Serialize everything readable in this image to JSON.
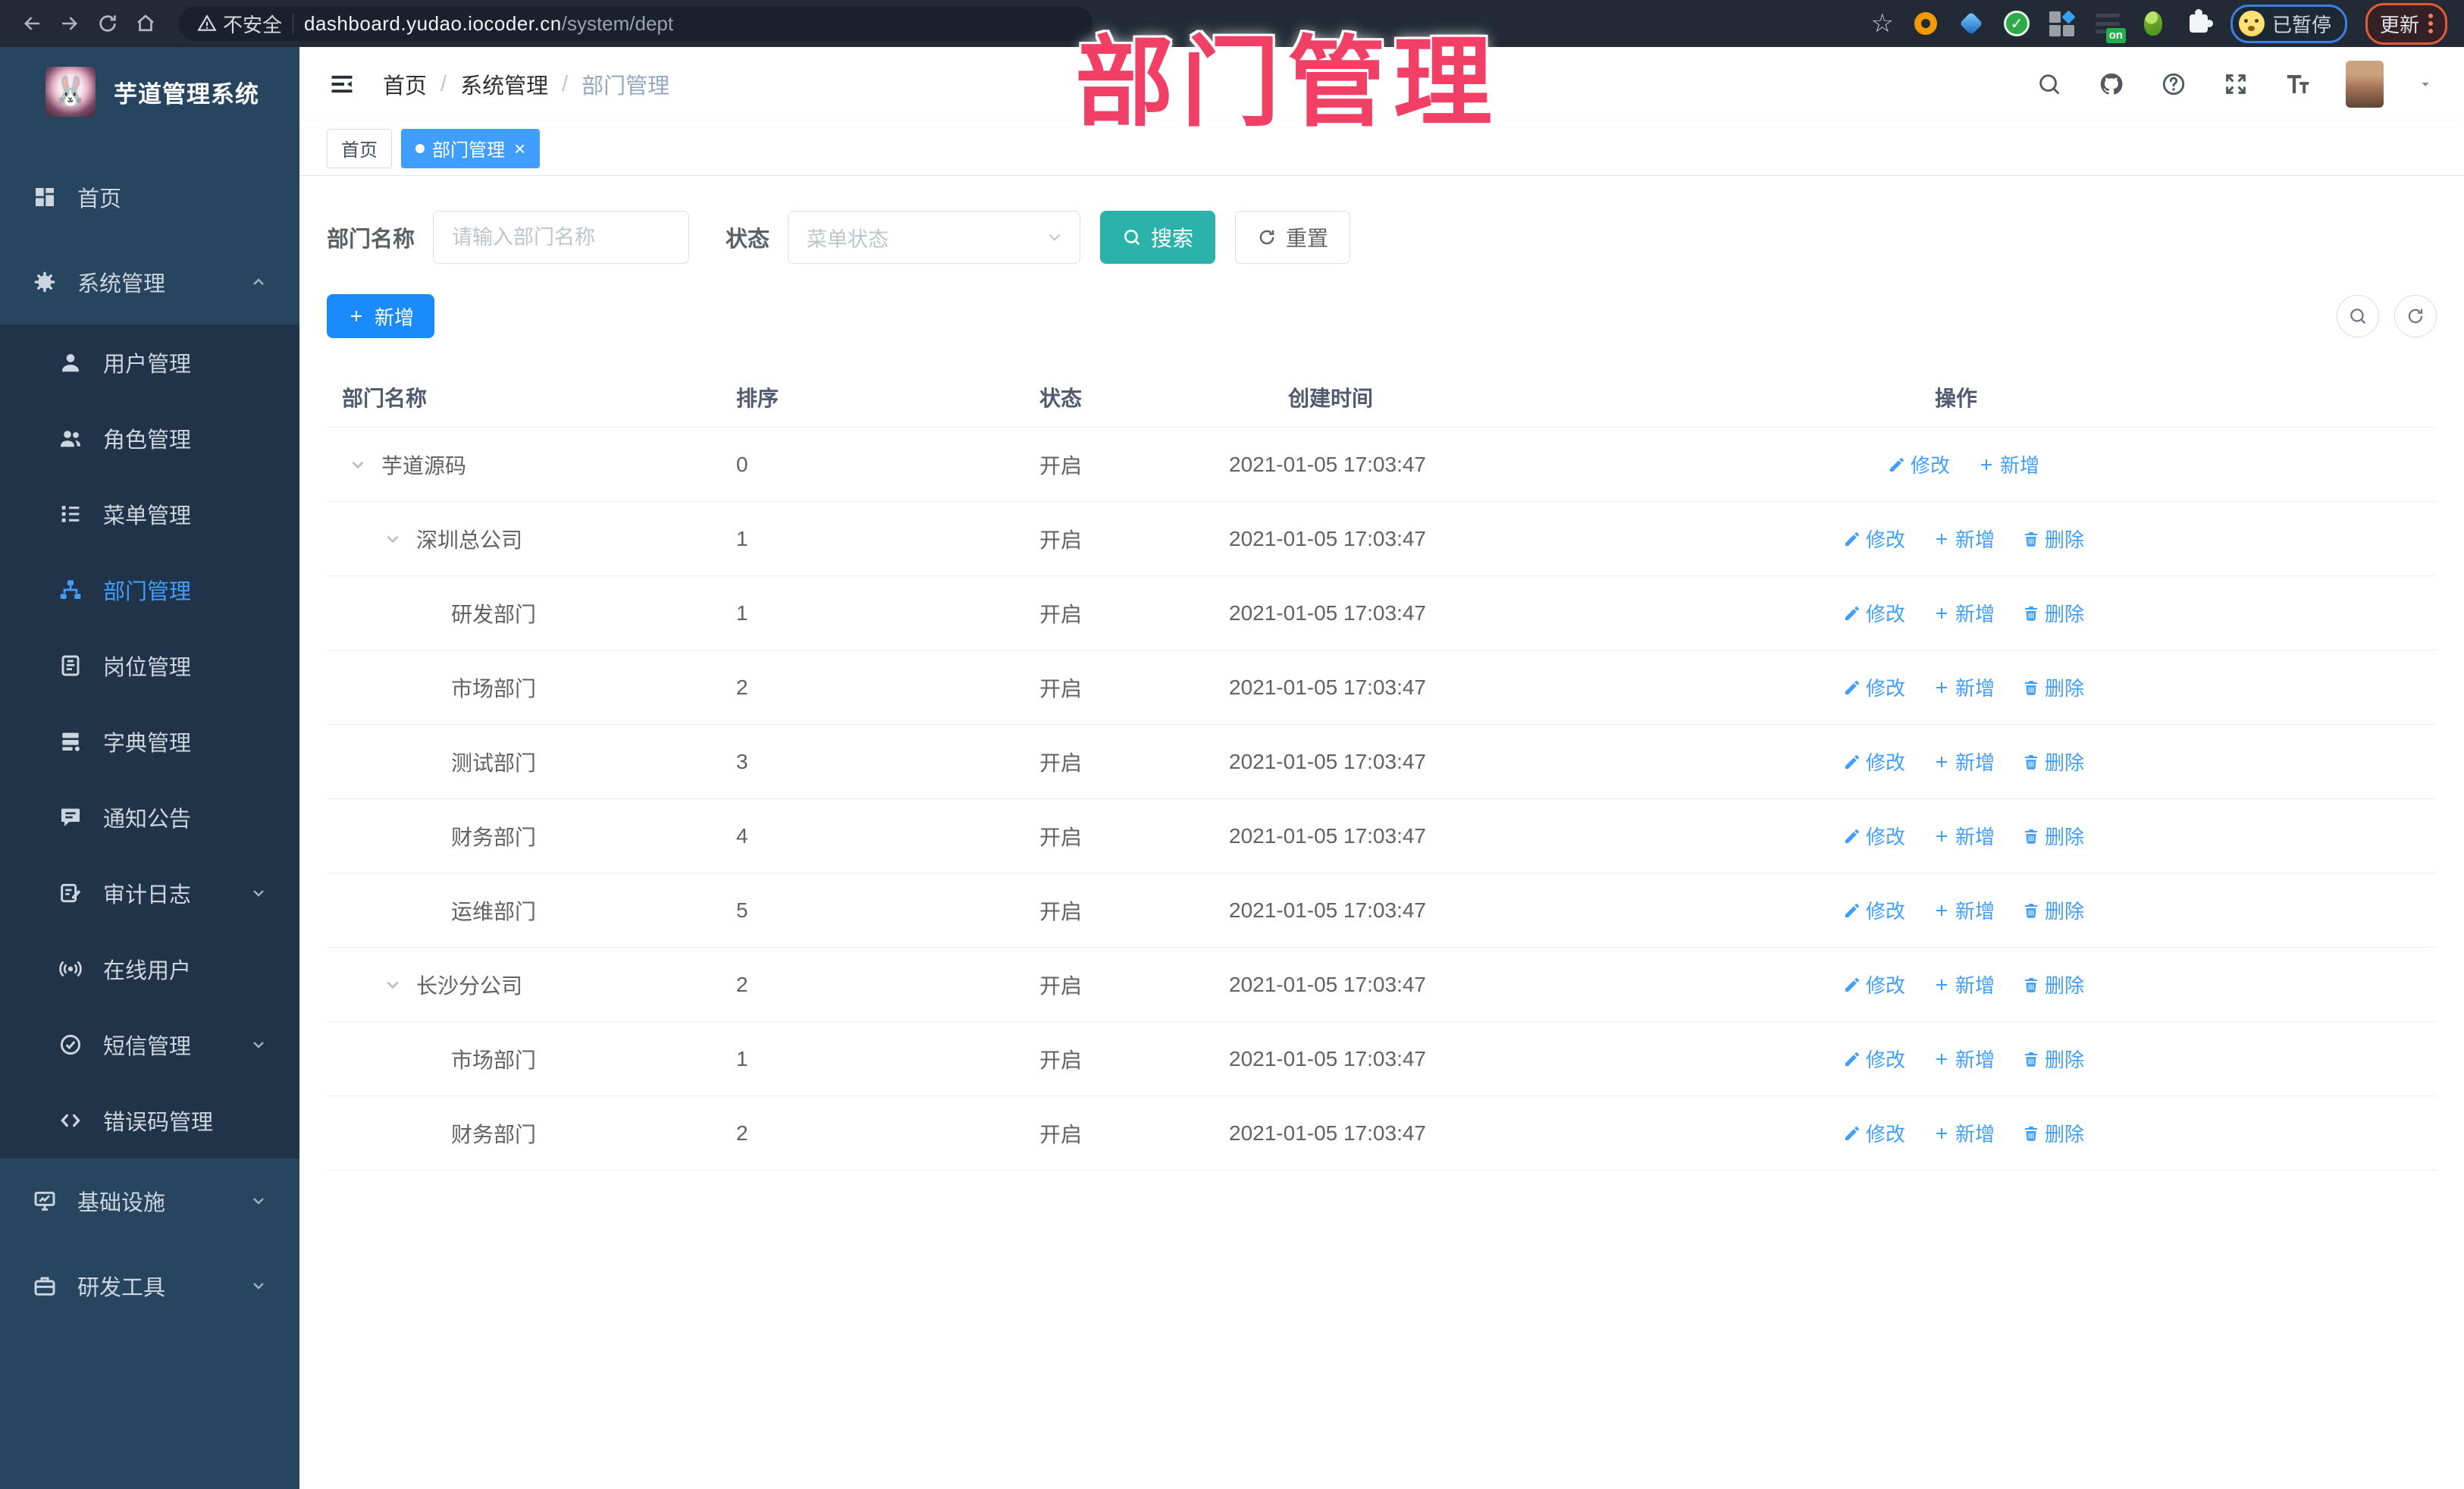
{
  "annotation": {
    "text": "部门管理",
    "color": "#f23f66"
  },
  "colors": {
    "accent_blue": "#409eff",
    "search_teal": "#2ab3ab",
    "add_blue": "#1b8bfb",
    "sidebar_bg": "#27455e",
    "submenu_bg": "#203348",
    "annotation_pink": "#f23f66"
  },
  "browser": {
    "security_text": "不安全",
    "url_host": "dashboard.yudao.iocoder.cn",
    "url_path": "/system/dept",
    "extension_badge": "on",
    "paused_label": "已暂停",
    "update_label": "更新",
    "extensions": [
      "orange-ring-icon",
      "blue-gem-icon",
      "green-check-icon",
      "tiles-icon",
      "switch-on-icon",
      "green-figure-icon",
      "puzzle-icon"
    ]
  },
  "sidebar": {
    "title": "芋道管理系统",
    "items": [
      {
        "label": "首页",
        "icon": "dashboard-icon",
        "type": "top"
      },
      {
        "label": "系统管理",
        "icon": "gear-icon",
        "type": "top",
        "chevron": "up"
      },
      {
        "label": "用户管理",
        "icon": "user-icon",
        "type": "sub"
      },
      {
        "label": "角色管理",
        "icon": "users-icon",
        "type": "sub"
      },
      {
        "label": "菜单管理",
        "icon": "menu-tree-icon",
        "type": "sub"
      },
      {
        "label": "部门管理",
        "icon": "org-chart-icon",
        "type": "sub",
        "active": true
      },
      {
        "label": "岗位管理",
        "icon": "id-badge-icon",
        "type": "sub"
      },
      {
        "label": "字典管理",
        "icon": "dictionary-icon",
        "type": "sub"
      },
      {
        "label": "通知公告",
        "icon": "announcement-icon",
        "type": "sub"
      },
      {
        "label": "审计日志",
        "icon": "audit-log-icon",
        "type": "sub",
        "chevron": "down"
      },
      {
        "label": "在线用户",
        "icon": "online-user-icon",
        "type": "sub"
      },
      {
        "label": "短信管理",
        "icon": "sms-icon",
        "type": "sub",
        "chevron": "down"
      },
      {
        "label": "错误码管理",
        "icon": "code-icon",
        "type": "sub"
      },
      {
        "label": "基础设施",
        "icon": "infrastructure-icon",
        "type": "top",
        "chevron": "down"
      },
      {
        "label": "研发工具",
        "icon": "dev-tools-icon",
        "type": "top",
        "chevron": "down"
      }
    ]
  },
  "header": {
    "breadcrumb": [
      "首页",
      "系统管理",
      "部门管理"
    ],
    "separator": "/"
  },
  "tabs": [
    {
      "label": "首页",
      "active": false,
      "closable": false
    },
    {
      "label": "部门管理",
      "active": true,
      "closable": true
    }
  ],
  "filters": {
    "name_label": "部门名称",
    "name_placeholder": "请输入部门名称",
    "status_label": "状态",
    "status_placeholder": "菜单状态",
    "search_label": "搜索",
    "reset_label": "重置"
  },
  "toolbar": {
    "add_label": "新增"
  },
  "ops_labels": {
    "edit": "修改",
    "add": "新增",
    "delete": "删除"
  },
  "table": {
    "columns": [
      "部门名称",
      "排序",
      "状态",
      "创建时间",
      "操作"
    ],
    "rows": [
      {
        "name": "芋道源码",
        "sort": "0",
        "status": "开启",
        "created": "2021-01-05 17:03:47",
        "level": 0,
        "expandable": true,
        "ops": [
          "edit",
          "add"
        ]
      },
      {
        "name": "深圳总公司",
        "sort": "1",
        "status": "开启",
        "created": "2021-01-05 17:03:47",
        "level": 1,
        "expandable": true,
        "ops": [
          "edit",
          "add",
          "delete"
        ]
      },
      {
        "name": "研发部门",
        "sort": "1",
        "status": "开启",
        "created": "2021-01-05 17:03:47",
        "level": 2,
        "expandable": false,
        "ops": [
          "edit",
          "add",
          "delete"
        ]
      },
      {
        "name": "市场部门",
        "sort": "2",
        "status": "开启",
        "created": "2021-01-05 17:03:47",
        "level": 2,
        "expandable": false,
        "ops": [
          "edit",
          "add",
          "delete"
        ]
      },
      {
        "name": "测试部门",
        "sort": "3",
        "status": "开启",
        "created": "2021-01-05 17:03:47",
        "level": 2,
        "expandable": false,
        "ops": [
          "edit",
          "add",
          "delete"
        ]
      },
      {
        "name": "财务部门",
        "sort": "4",
        "status": "开启",
        "created": "2021-01-05 17:03:47",
        "level": 2,
        "expandable": false,
        "ops": [
          "edit",
          "add",
          "delete"
        ]
      },
      {
        "name": "运维部门",
        "sort": "5",
        "status": "开启",
        "created": "2021-01-05 17:03:47",
        "level": 2,
        "expandable": false,
        "ops": [
          "edit",
          "add",
          "delete"
        ]
      },
      {
        "name": "长沙分公司",
        "sort": "2",
        "status": "开启",
        "created": "2021-01-05 17:03:47",
        "level": 1,
        "expandable": true,
        "ops": [
          "edit",
          "add",
          "delete"
        ]
      },
      {
        "name": "市场部门",
        "sort": "1",
        "status": "开启",
        "created": "2021-01-05 17:03:47",
        "level": 2,
        "expandable": false,
        "ops": [
          "edit",
          "add",
          "delete"
        ]
      },
      {
        "name": "财务部门",
        "sort": "2",
        "status": "开启",
        "created": "2021-01-05 17:03:47",
        "level": 2,
        "expandable": false,
        "ops": [
          "edit",
          "add",
          "delete"
        ]
      }
    ]
  }
}
